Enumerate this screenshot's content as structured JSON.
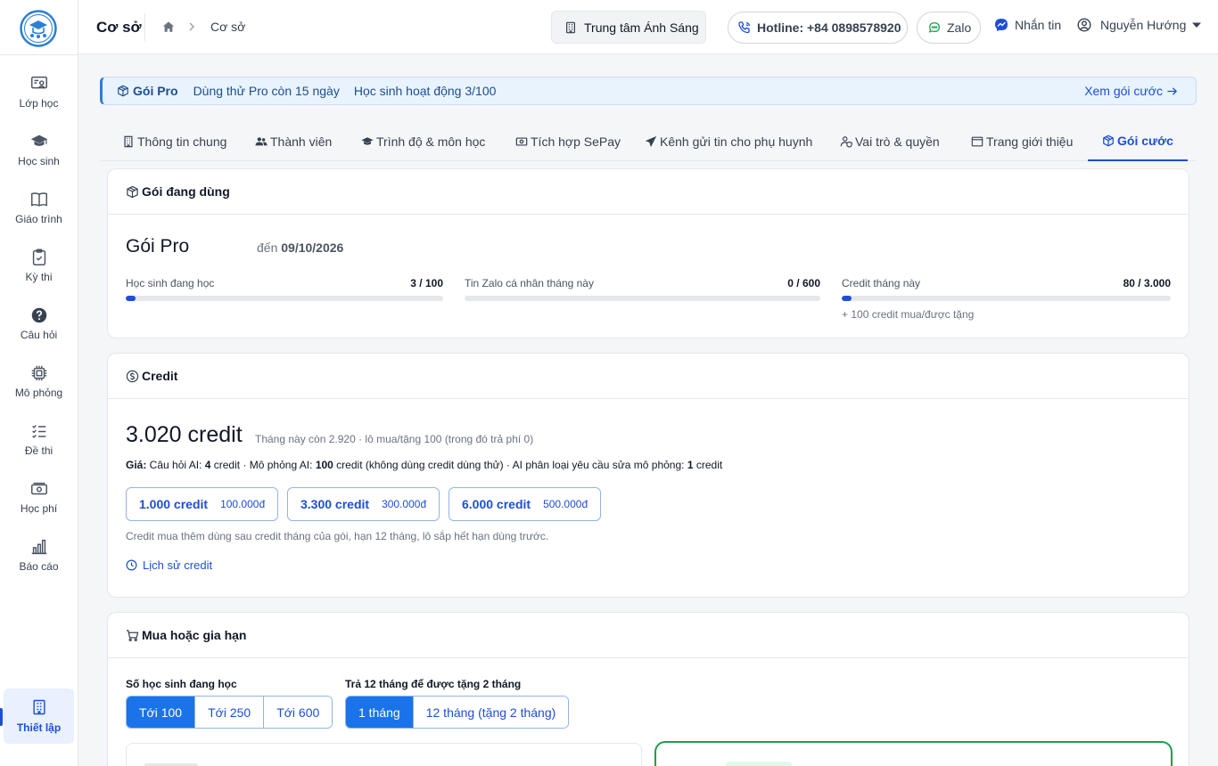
{
  "sidebar": {
    "items": [
      {
        "label": "Lớp học",
        "icon": "classroom-icon"
      },
      {
        "label": "Học sinh",
        "icon": "graduation-cap-icon"
      },
      {
        "label": "Giáo trình",
        "icon": "book-icon"
      },
      {
        "label": "Kỳ thi",
        "icon": "clipboard-check-icon"
      },
      {
        "label": "Câu hỏi",
        "icon": "question-circle-icon"
      },
      {
        "label": "Mô phỏng",
        "icon": "chip-icon"
      },
      {
        "label": "Đề thi",
        "icon": "checklist-icon"
      },
      {
        "label": "Học phí",
        "icon": "money-icon"
      },
      {
        "label": "Báo cáo",
        "icon": "bar-chart-icon"
      }
    ],
    "active": {
      "label": "Thiết lập",
      "icon": "building-icon"
    }
  },
  "header": {
    "title": "Cơ sở",
    "breadcrumb": "Cơ sở",
    "center_name": "Trung tâm Ánh Sáng",
    "hotline": "Hotline: +84 0898578920",
    "zalo": "Zalo",
    "message": "Nhắn tin",
    "user_name": "Nguyễn Hướng"
  },
  "banner": {
    "plan": "Gói Pro",
    "trial": "Dùng thử Pro còn 15 ngày",
    "active_students": "Học sinh hoạt động 3/100",
    "link": "Xem gói cước"
  },
  "tabs": [
    {
      "label": "Thông tin chung",
      "icon": "building-icon"
    },
    {
      "label": "Thành viên",
      "icon": "users-icon"
    },
    {
      "label": "Trình độ & môn học",
      "icon": "graduation-cap-icon"
    },
    {
      "label": "Tích hợp SePay",
      "icon": "money-icon"
    },
    {
      "label": "Kênh gửi tin cho phụ huynh",
      "icon": "send-icon"
    },
    {
      "label": "Vai trò & quyền",
      "icon": "user-shield-icon"
    },
    {
      "label": "Trang giới thiệu",
      "icon": "browser-icon"
    },
    {
      "label": "Gói cước",
      "icon": "package-icon"
    }
  ],
  "current_plan": {
    "heading": "Gói đang dùng",
    "name": "Gói Pro",
    "until_prefix": "đến",
    "until_date": "09/10/2026",
    "usage": [
      {
        "label": "Học sinh đang học",
        "value": "3 / 100",
        "fraction": 0.03,
        "note": ""
      },
      {
        "label": "Tin Zalo cá nhân tháng này",
        "value": "0 / 600",
        "fraction": 0.0,
        "note": ""
      },
      {
        "label": "Credit tháng này",
        "value": "80 / 3.000",
        "fraction": 0.027,
        "note": "+ 100 credit mua/được tặng"
      }
    ]
  },
  "credit": {
    "heading": "Credit",
    "total": "3.020 credit",
    "detail": "Tháng này còn 2.920 · lô mua/tặng 100 (trong đó trả phí 0)",
    "price_label": "Giá:",
    "price_parts": [
      {
        "text": " Câu hỏi AI: ",
        "bold": false
      },
      {
        "text": "4",
        "bold": true
      },
      {
        "text": " credit · Mô phỏng AI: ",
        "bold": false
      },
      {
        "text": "100",
        "bold": true
      },
      {
        "text": " credit (không dùng credit dùng thử) · AI phân loại yêu cầu sửa mô phỏng: ",
        "bold": false
      },
      {
        "text": "1",
        "bold": true
      },
      {
        "text": " credit",
        "bold": false
      }
    ],
    "packs": [
      {
        "credits": "1.000 credit",
        "price": "100.000đ"
      },
      {
        "credits": "3.300 credit",
        "price": "300.000đ"
      },
      {
        "credits": "6.000 credit",
        "price": "500.000đ"
      }
    ],
    "note": "Credit mua thêm dùng sau credit tháng của gói, hạn 12 tháng, lô sắp hết hạn dùng trước.",
    "history": "Lịch sử credit"
  },
  "purchase": {
    "heading": "Mua hoặc gia hạn",
    "students_label": "Số học sinh đang học",
    "students_options": [
      "Tới 100",
      "Tới 250",
      "Tới 600"
    ],
    "students_selected": 0,
    "period_label": "Trả 12 tháng để được tặng 2 tháng",
    "period_options": [
      "1 tháng",
      "12 tháng (tặng 2 tháng)"
    ],
    "period_selected": 0
  },
  "colors": {
    "accent": "#1d4ed8",
    "selected_fill": "#1a73e8",
    "banner_bg": "#e8f3fd",
    "success": "#16a34a"
  }
}
